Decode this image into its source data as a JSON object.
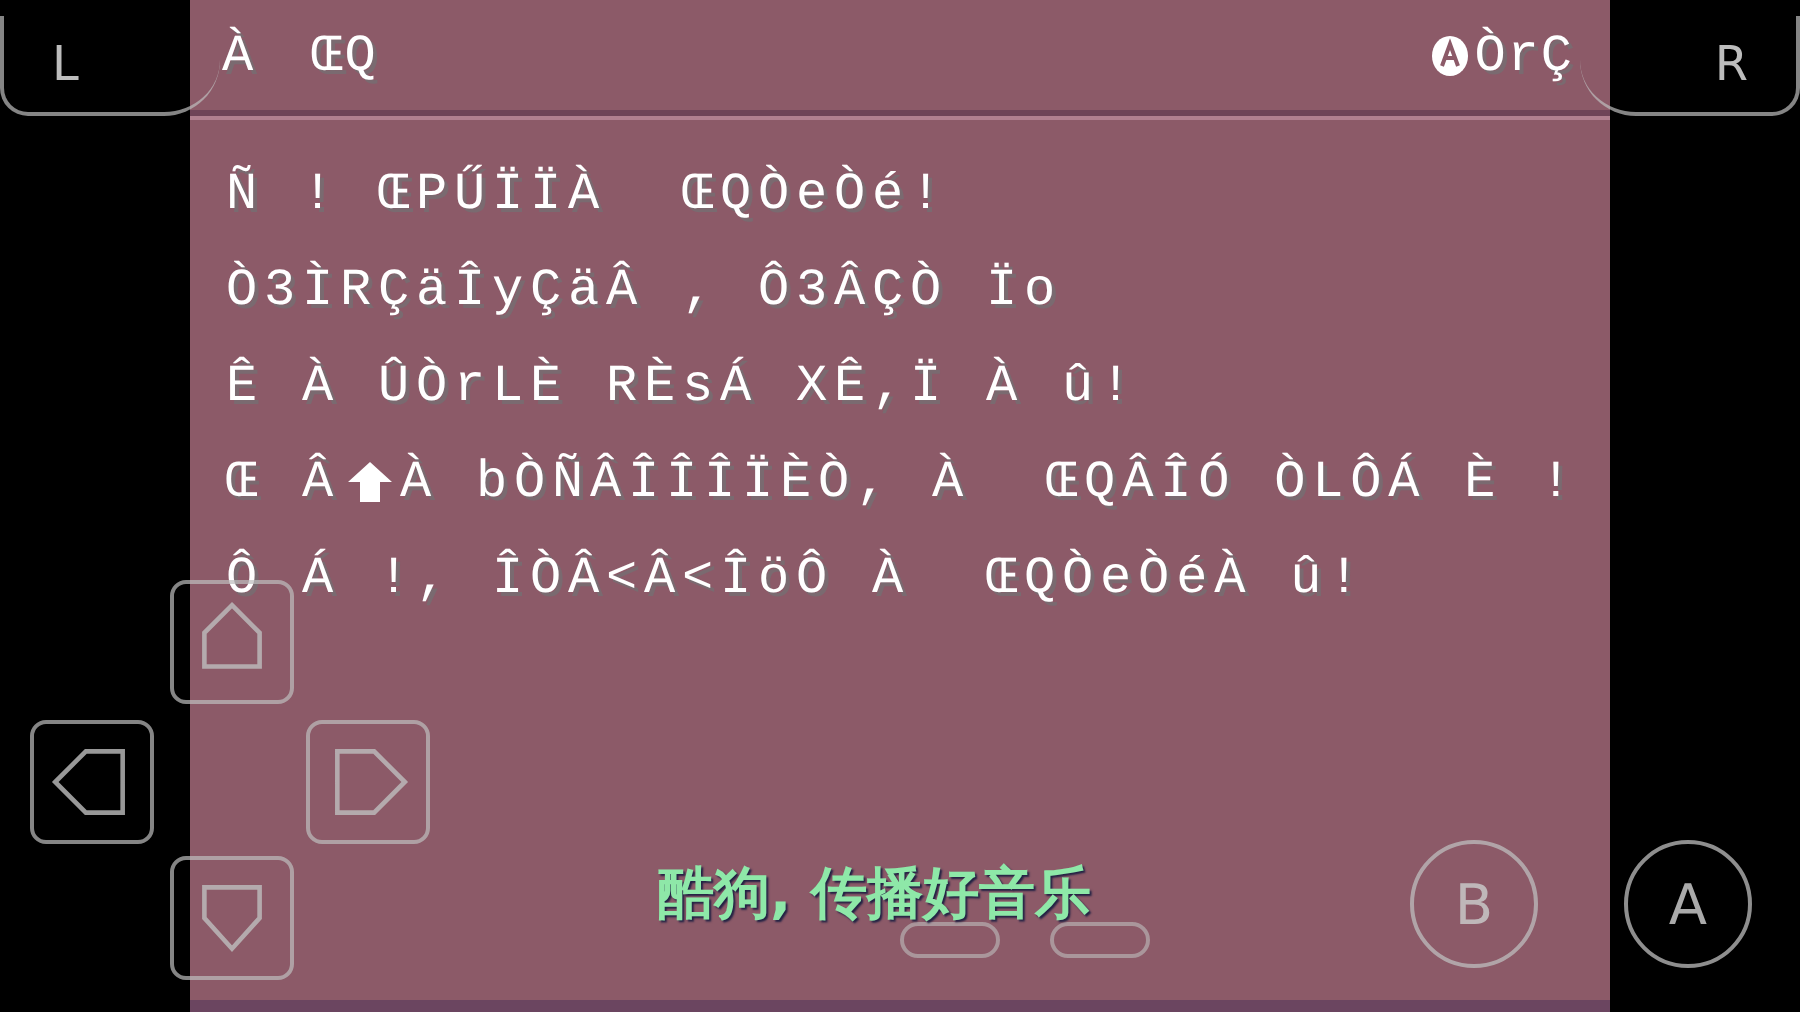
{
  "header": {
    "left": [
      "À",
      "ŒQ"
    ],
    "right": "ÒrÇ"
  },
  "dialog": {
    "lines": [
      [
        {
          "kind": "text",
          "text": "Ñ ! ŒPŰÏÏÀ  ŒQÒeÒé!"
        }
      ],
      [
        {
          "kind": "text",
          "text": "Ò3ÌRÇäÎyÇäÂ , Ô3ÂÇÒ Ïo"
        }
      ],
      [
        {
          "kind": "text",
          "text": "Ê À ÛÒrLÈ RÈsÁ XÊ,Ï À û!"
        }
      ],
      [
        {
          "kind": "text",
          "text": "Œ Â"
        },
        {
          "kind": "arrow"
        },
        {
          "kind": "text",
          "text": "À bÒÑÂÎÎÎÏÈÒ, À  ŒQÂÎÓ ÒLÔÁ È !"
        }
      ],
      [
        {
          "kind": "text",
          "text": "Ô Á !, ÎÒÂ<Â<ÎöÔ À  ŒQÒeÒéÀ û!"
        }
      ]
    ]
  },
  "shoulder_buttons": [
    "L",
    "R"
  ],
  "face_buttons": [
    "B",
    "A"
  ],
  "subtitle": "酷狗, 传播好音乐"
}
